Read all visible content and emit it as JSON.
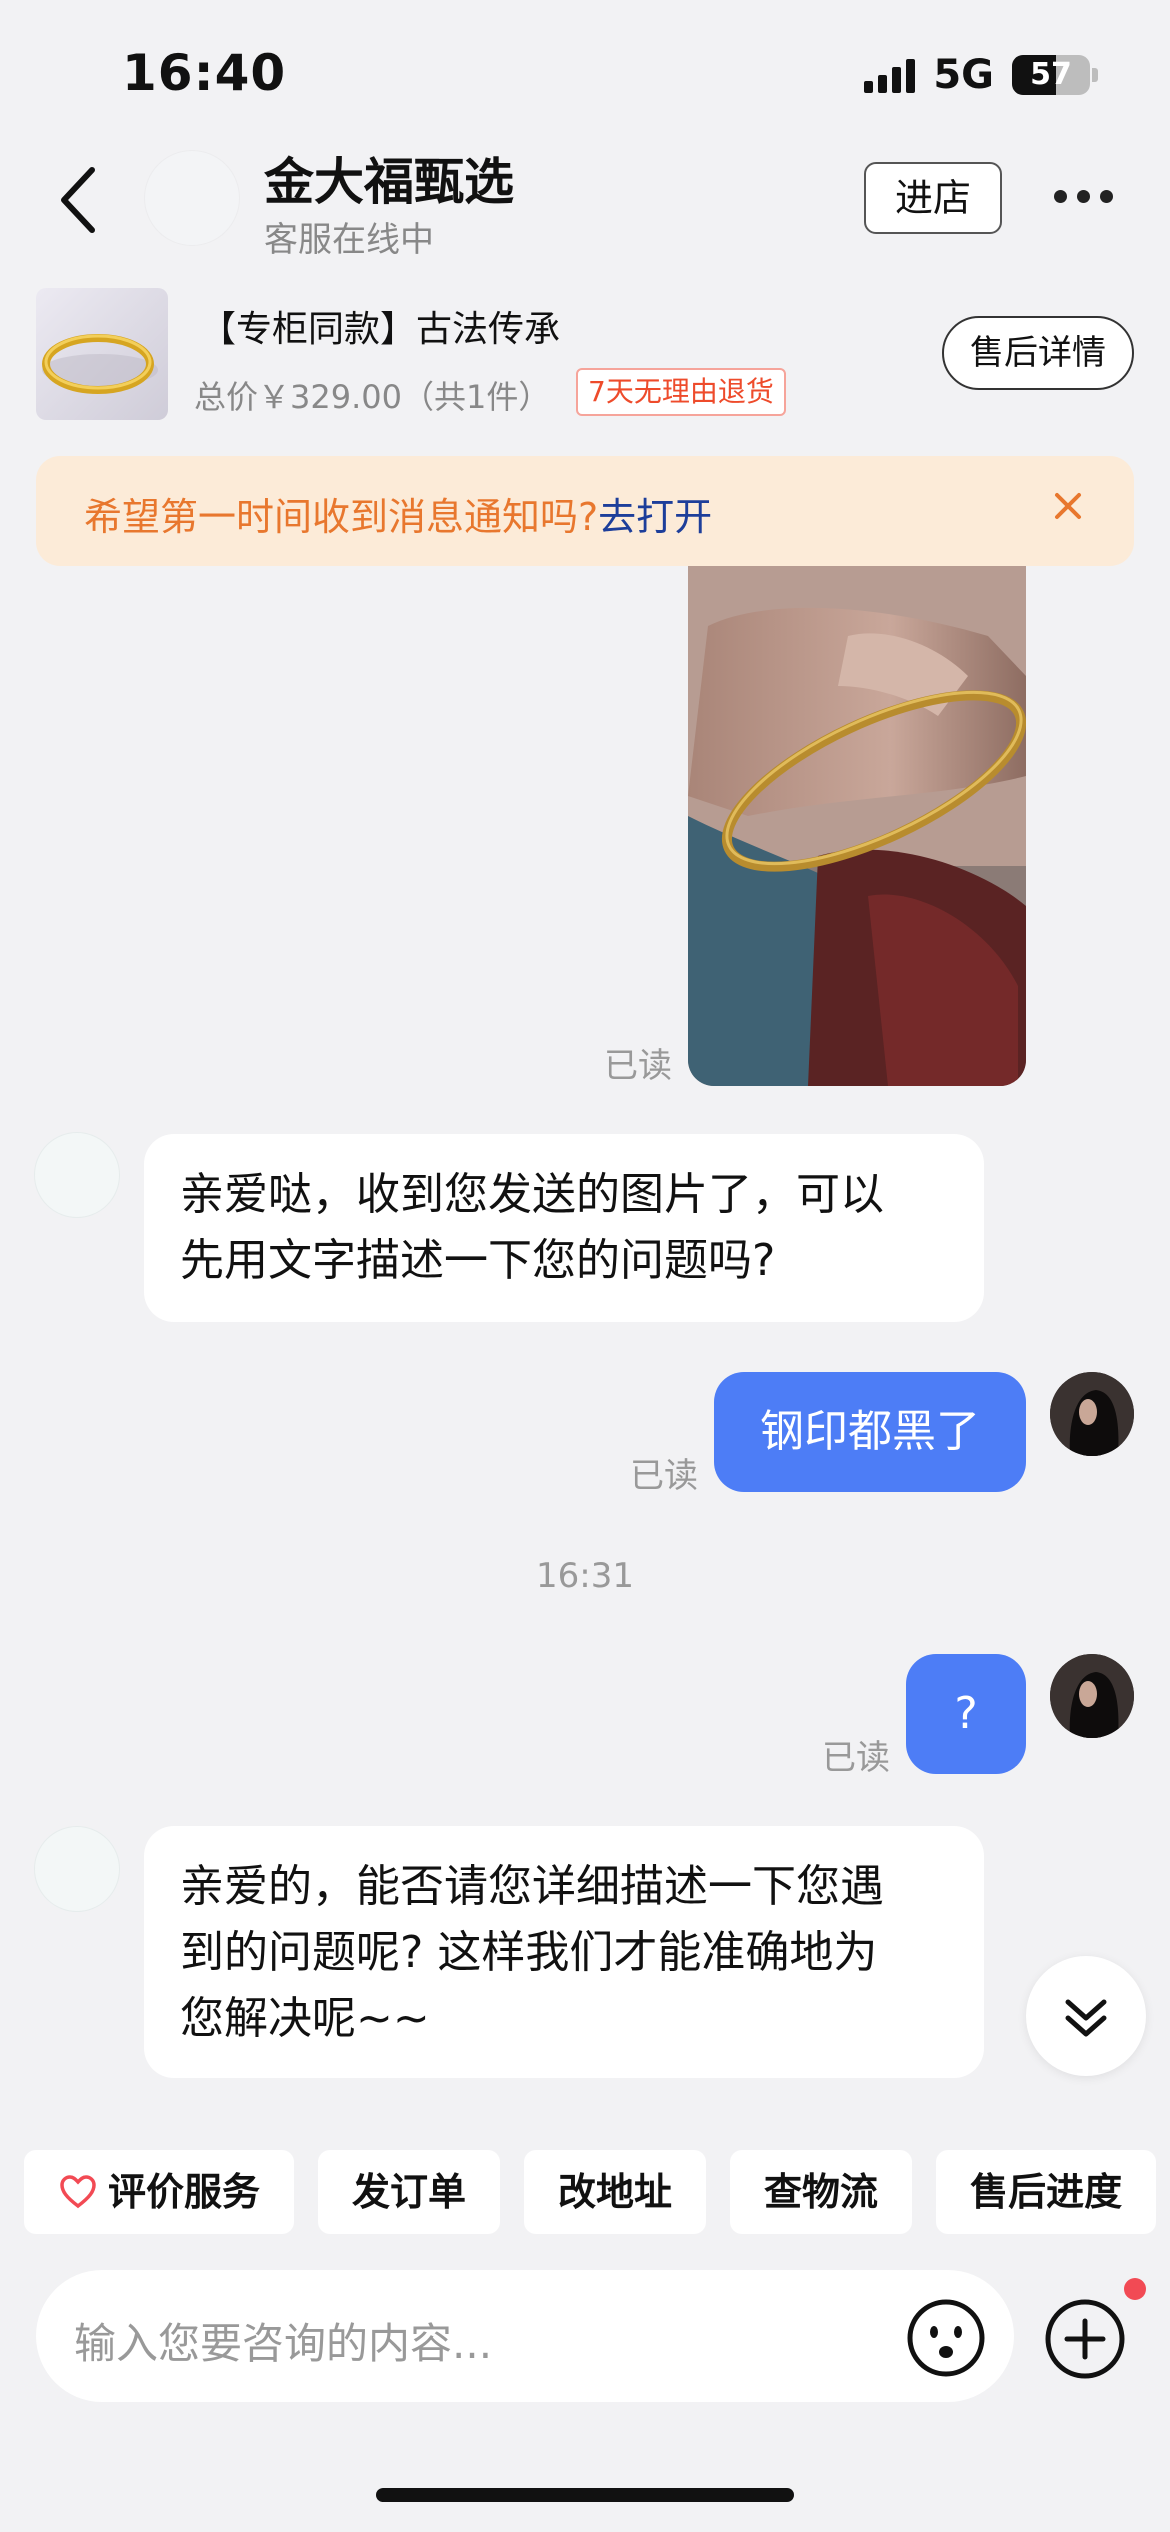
{
  "status_bar": {
    "time": "16:40",
    "network": "5G",
    "battery": "57"
  },
  "header": {
    "shop_name": "金大福甄选",
    "shop_status": "客服在线中",
    "enter_store": "进店"
  },
  "product": {
    "title": "【专柜同款】古法传承",
    "price_line": "总价￥329.00（共1件）",
    "return_policy": "7天无理由退货",
    "after_sale_button": "售后详情"
  },
  "notification": {
    "text": "希望第一时间收到消息通知吗?",
    "link": "去打开"
  },
  "messages": [
    {
      "from": "me",
      "type": "image",
      "read": "已读"
    },
    {
      "from": "cs",
      "lines": [
        "亲爱哒，收到您发送的图片了，可以",
        "先用文字描述一下您的问题吗?"
      ]
    },
    {
      "from": "me",
      "text": "钢印都黑了",
      "read": "已读"
    },
    {
      "from": "system",
      "text": "16:31"
    },
    {
      "from": "me",
      "text": "?",
      "read": "已读"
    },
    {
      "from": "cs",
      "lines": [
        "亲爱的，能否请您详细描述一下您遇",
        "到的问题呢? 这样我们才能准确地为",
        "您解决呢~~"
      ]
    }
  ],
  "quick_actions": [
    "评价服务",
    "发订单",
    "改地址",
    "查物流",
    "售后进度"
  ],
  "input": {
    "placeholder": "输入您要咨询的内容..."
  },
  "colors": {
    "accent_blue": "#4d7df6",
    "notice_orange": "#e8772e",
    "notice_bg": "#fcebd8",
    "alert_red": "#f24a54"
  }
}
